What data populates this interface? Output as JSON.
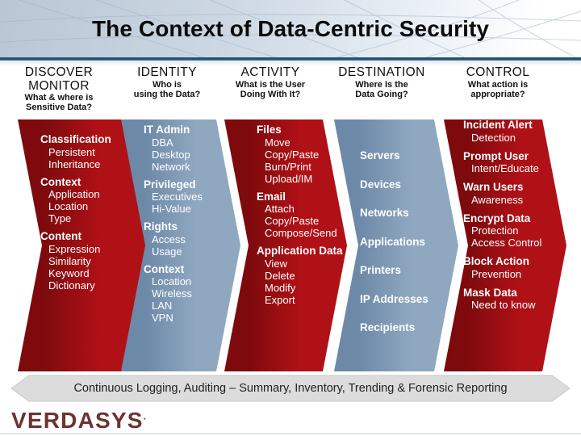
{
  "header": {
    "title": "The Context of Data-Centric Security",
    "underline_color": "#1d4a66"
  },
  "columns": [
    {
      "id": "discover-monitor",
      "heading": "DISCOVER",
      "heading_line2": "MONITOR",
      "sub1": "What & where is",
      "sub2": "Sensitive Data?",
      "color": "#b01116",
      "color_dark": "#7e0a0d",
      "groups": [
        {
          "title": "Classification",
          "items": [
            "Persistent",
            "Inheritance"
          ]
        },
        {
          "title": "Context",
          "items": [
            "Application",
            "Location",
            "Type"
          ]
        },
        {
          "title": "Content",
          "items": [
            "Expression",
            "Similarity",
            "Keyword",
            "Dictionary"
          ]
        }
      ]
    },
    {
      "id": "identity",
      "heading": "IDENTITY",
      "heading_line2": "",
      "sub1": "Who is",
      "sub2": "using the Data?",
      "color": "#8fa8c0",
      "color_dark": "#6d89a8",
      "groups": [
        {
          "title": "IT Admin",
          "items": [
            "DBA",
            "Desktop",
            "Network"
          ]
        },
        {
          "title": "Privileged",
          "items": [
            "Executives",
            "Hi-Value"
          ]
        },
        {
          "title": "Rights",
          "items": [
            "Access",
            "Usage"
          ]
        },
        {
          "title": "Context",
          "items": [
            "Location",
            "Wireless",
            "LAN",
            "VPN"
          ]
        }
      ]
    },
    {
      "id": "activity",
      "heading": "ACTIVITY",
      "heading_line2": "",
      "sub1": "What is the User",
      "sub2": "Doing With It?",
      "color": "#b01116",
      "color_dark": "#7e0a0d",
      "groups": [
        {
          "title": "Files",
          "items": [
            "Move",
            "Copy/Paste",
            "Burn/Print",
            "Upload/IM"
          ]
        },
        {
          "title": "Email",
          "items": [
            "Attach",
            "Copy/Paste",
            "Compose/Send"
          ]
        },
        {
          "title": "Application Data",
          "items": [
            "View",
            "Delete",
            "Modify",
            "Export"
          ]
        }
      ]
    },
    {
      "id": "destination",
      "heading": "DESTINATION",
      "heading_line2": "",
      "sub1": "Where Is the",
      "sub2": "Data Going?",
      "color": "#8fa8c0",
      "color_dark": "#6d89a8",
      "groups": [
        {
          "title": "Servers",
          "items": []
        },
        {
          "title": "Devices",
          "items": []
        },
        {
          "title": "Networks",
          "items": []
        },
        {
          "title": "Applications",
          "items": []
        },
        {
          "title": "Printers",
          "items": []
        },
        {
          "title": "IP Addresses",
          "items": []
        },
        {
          "title": "Recipients",
          "items": []
        }
      ]
    },
    {
      "id": "control",
      "heading": "CONTROL",
      "heading_line2": "",
      "sub1": "What action is",
      "sub2": "appropriate?",
      "color": "#b01116",
      "color_dark": "#7e0a0d",
      "groups": [
        {
          "title": "Incident Alert",
          "items": [
            "Detection"
          ]
        },
        {
          "title": "Prompt User",
          "items": [
            "Intent/Educate"
          ]
        },
        {
          "title": "Warn Users",
          "items": [
            "Awareness"
          ]
        },
        {
          "title": "Encrypt Data",
          "items": [
            "Protection",
            "Access Control"
          ]
        },
        {
          "title": "Block Action",
          "items": [
            "Prevention"
          ]
        },
        {
          "title": "Mask Data",
          "items": [
            "Need to know"
          ]
        }
      ]
    }
  ],
  "bottom_banner": {
    "text": "Continuous Logging, Auditing – Summary, Inventory, Trending & Forensic Reporting",
    "fill": "#dcdcdc"
  },
  "logo": {
    "text": "VERDASYS",
    "trademark": ".",
    "color": "#6e3232"
  }
}
